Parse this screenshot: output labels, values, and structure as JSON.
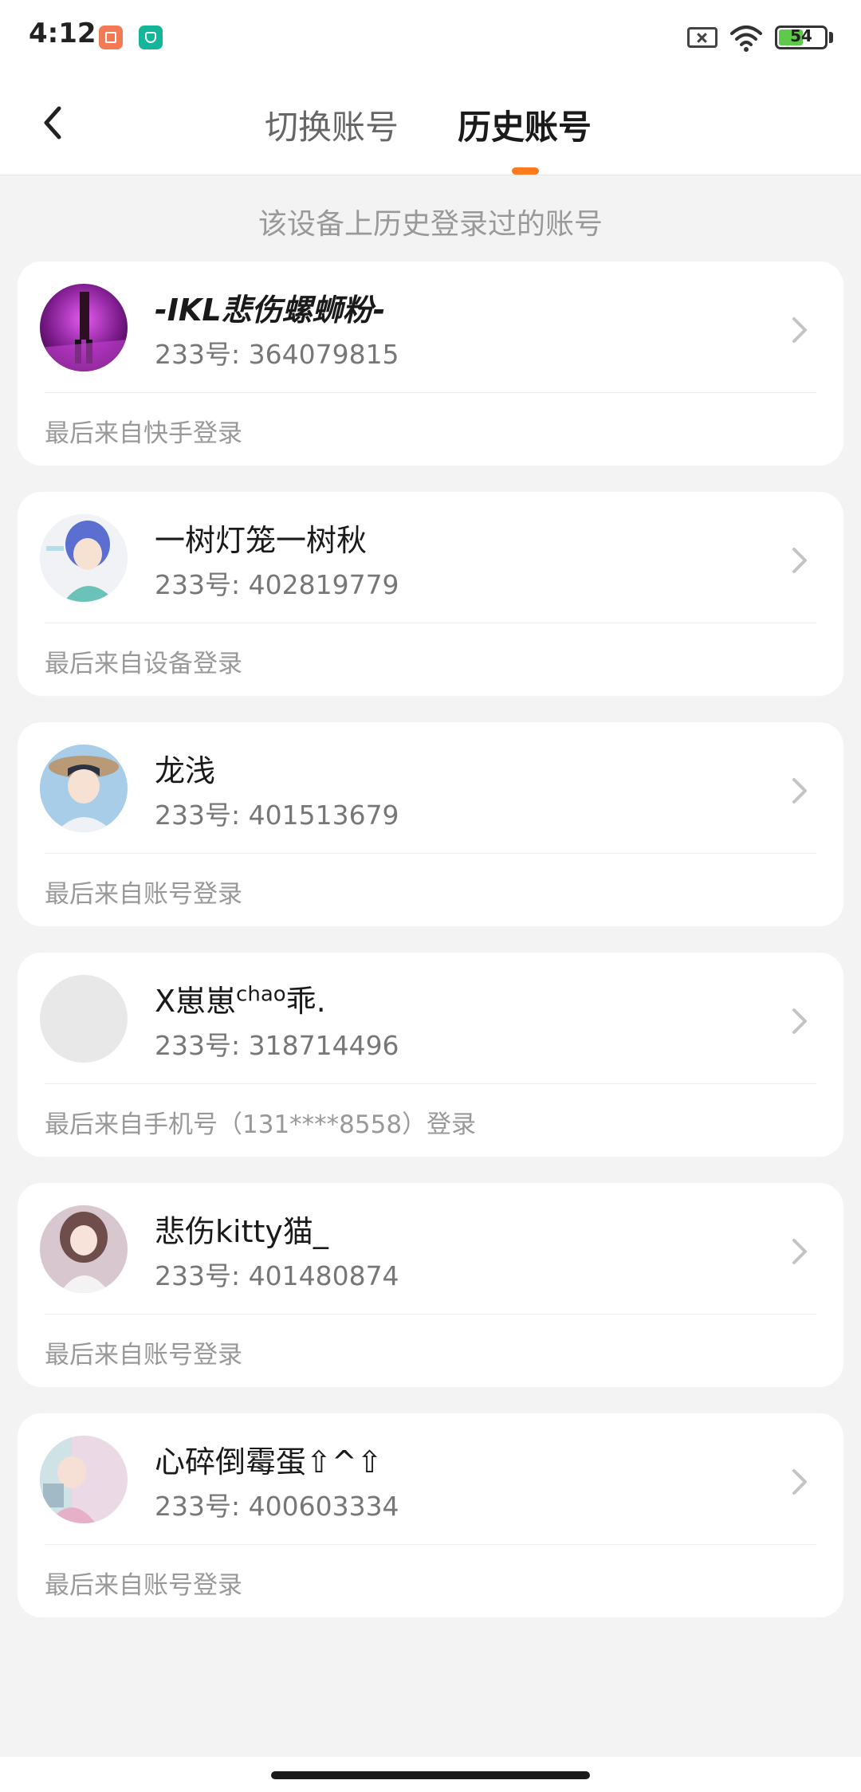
{
  "status_bar": {
    "time": "4:12",
    "battery": "54",
    "battery_level": 0.54,
    "icons": [
      "orange-app-icon",
      "shield-app-icon",
      "sim-x-icon",
      "wifi-icon",
      "battery-icon"
    ]
  },
  "header": {
    "back_icon": "chevron-left-icon",
    "tabs": [
      {
        "label": "切换账号",
        "active": false
      },
      {
        "label": "历史账号",
        "active": true
      }
    ],
    "accent_color": "#ff7a1e"
  },
  "hint": "该设备上历史登录过的账号",
  "accounts": [
    {
      "name": "-IKL悲伤螺蛳粉-",
      "id_line": "233号: 364079815",
      "source": "最后来自快手登录",
      "avatar": "purple-stage-avatar"
    },
    {
      "name": "一树灯笼一树秋",
      "id_line": "233号: 402819779",
      "source": "最后来自设备登录",
      "avatar": "anime-blue-hair-avatar"
    },
    {
      "name": "龙浅",
      "id_line": "233号: 401513679",
      "source": "最后来自账号登录",
      "avatar": "anime-sunhat-avatar"
    },
    {
      "name": "X崽崽",
      "name_sup": "chao",
      "name_suffix": "乖.",
      "id_line": "233号: 318714496",
      "source": "最后来自手机号（131****8558）登录",
      "avatar": "placeholder-avatar"
    },
    {
      "name": "悲伤kitty猫_",
      "id_line": "233号: 401480874",
      "source": "最后来自账号登录",
      "avatar": "anime-girl-white-dress-avatar"
    },
    {
      "name": "心碎倒霉蛋⇧^⇧",
      "id_line": "233号: 400603334",
      "source": "最后来自账号登录",
      "avatar": "anime-pink-avatar"
    }
  ]
}
